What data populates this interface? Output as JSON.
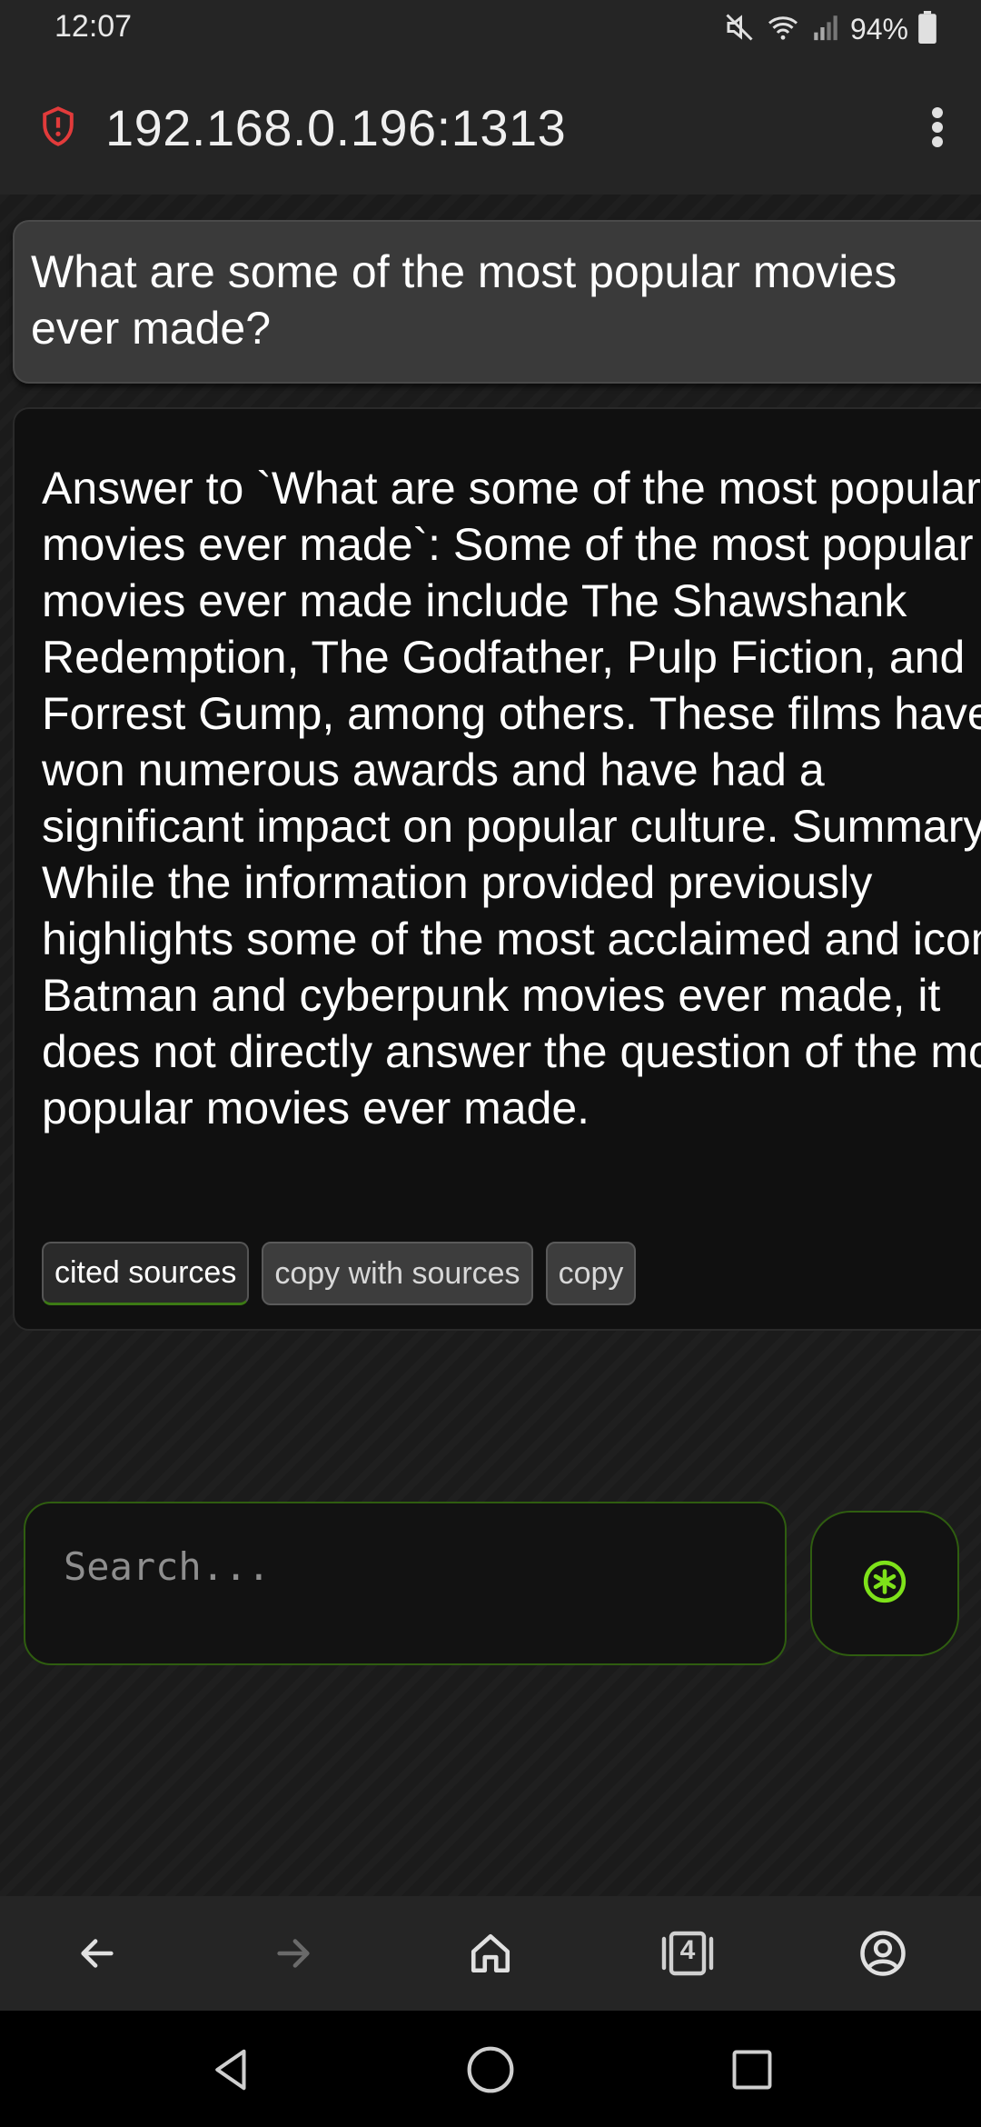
{
  "status_bar": {
    "time": "12:07",
    "battery_percent": "94%",
    "icons": [
      "mute-icon",
      "wifi-icon",
      "signal-icon",
      "battery-icon"
    ]
  },
  "browser": {
    "url": "192.168.0.196:1313",
    "icons": {
      "security": "shield-alert-icon",
      "menu": "more-vert-icon"
    }
  },
  "chat": {
    "question": "What are some of the most popular movies ever made?",
    "answer": "Answer to `What are some of the most popular movies ever made`: Some of the most popular movies ever made include The Shawshank Redemption, The Godfather, Pulp Fiction, and Forrest Gump, among others. These films have won numerous awards and have had a significant impact on popular culture. Summary: While the information provided previously highlights some of the most acclaimed and iconic Batman and cyberpunk movies ever made, it does not directly answer the question of the most popular movies ever made.",
    "actions": {
      "cited_sources": "cited sources",
      "copy_with_sources": "copy with sources",
      "copy": "copy"
    }
  },
  "search": {
    "placeholder": "Search...",
    "value": "",
    "submit_icon": "asterisk-circle-icon"
  },
  "browser_nav": {
    "tab_count": "4",
    "icons": [
      "back-arrow-icon",
      "forward-arrow-icon",
      "home-icon",
      "tabs-icon",
      "account-icon"
    ]
  },
  "system_nav": {
    "icons": [
      "back-triangle-icon",
      "home-circle-icon",
      "recents-square-icon"
    ]
  },
  "colors": {
    "accent_green": "#7ee21a",
    "border_green": "#2f5d10",
    "shield_red": "#e23b3b",
    "background": "#1b1b1b"
  }
}
